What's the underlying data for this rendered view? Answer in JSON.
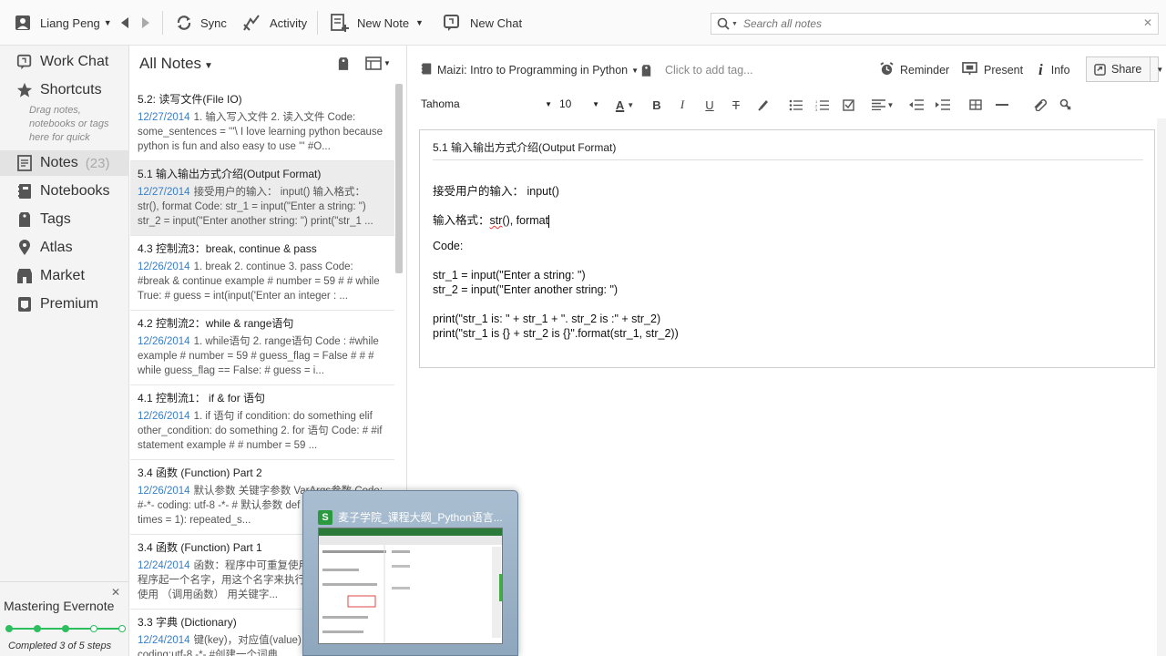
{
  "topbar": {
    "user": "Liang Peng",
    "sync": "Sync",
    "activity": "Activity",
    "new_note": "New Note",
    "new_chat": "New Chat",
    "search_placeholder": "Search all notes"
  },
  "sidebar": {
    "work_chat": "Work Chat",
    "shortcuts": "Shortcuts",
    "hint": "Drag notes, notebooks or tags here for quick",
    "notes": "Notes",
    "notes_count": "(23)",
    "notebooks": "Notebooks",
    "tags": "Tags",
    "atlas": "Atlas",
    "market": "Market",
    "premium": "Premium",
    "mastery_title": "Mastering Evernote",
    "mastery_caption": "Completed 3 of 5 steps",
    "mastery_progress": 0.6
  },
  "notes_list": {
    "header": "All Notes",
    "items": [
      {
        "title": "5.2: 读写文件(File IO)",
        "date": "12/27/2014",
        "body": "1. 输入写入文件 2. 读入文件 Code: some_sentences = '''\\ I love learning python because python is fun and also easy to use ''' #O..."
      },
      {
        "title": "5.1 输入输出方式介绍(Output Format)",
        "date": "12/27/2014",
        "body": "接受用户的输入： input() 输入格式： str(), format Code: str_1 = input(\"Enter a string: \") str_2 = input(\"Enter another string: \") print(\"str_1 ..."
      },
      {
        "title": "4.3 控制流3：break, continue & pass",
        "date": "12/26/2014",
        "body": "1. break 2. continue 3. pass Code: #break & continue example # number = 59 # # while True: # guess = int(input('Enter an integer : ..."
      },
      {
        "title": "4.2 控制流2：while & range语句",
        "date": "12/26/2014",
        "body": "1. while语句 2. range语句 Code : #while example # number = 59 # guess_flag = False # # # while guess_flag == False: # guess = i..."
      },
      {
        "title": "4.1 控制流1： if & for 语句",
        "date": "12/26/2014",
        "body": "1. if 语句 if condition: do something elif other_condition: do something 2. for 语句 Code: # #if statement example # # number = 59 ..."
      },
      {
        "title": "3.4 函数 (Function) Part 2",
        "date": "12/26/2014",
        "body": "默认参数 关键字参数 VarArgs参数 Code: #-*- coding: utf-8 -*- # 默认参数 def repeat_str(s, times = 1): repeated_s..."
      },
      {
        "title": "3.4 函数 (Function) Part 1",
        "date": "12/24/2014",
        "body": "函数：程序中可重复使用的程序段 给一段程序起一个名字，用这个名字来执行一段程序，反复使用 （调用函数） 用关键字..."
      },
      {
        "title": "3.3 字典 (Dictionary)",
        "date": "12/24/2014",
        "body": "键(key)，对应值(value) Code: #-*- coding:utf-8 -*- #创建一个词典..."
      }
    ]
  },
  "editor": {
    "notebook": "Maizi: Intro to Programming in Python",
    "tag_placeholder": "Click to add tag...",
    "reminder": "Reminder",
    "present": "Present",
    "info": "Info",
    "share": "Share",
    "font": "Tahoma",
    "size": "10",
    "title": "5.1 输入输出方式介绍(Output Format)",
    "line1": "接受用户的输入：  input()",
    "line2_a": "输入格式：",
    "line2_b": "str",
    "line2_c": "(), format",
    "line3": "Code:",
    "line4": "str_1 = input(\"Enter a string: \")",
    "line5": "str_2 = input(\"Enter another string: \")",
    "line6": "print(\"str_1 is: \" + str_1 + \". str_2 is :\" + str_2)",
    "line7": "print(\"str_1 is {} + str_2 is {}\".format(str_1, str_2))"
  },
  "preview": {
    "title": "麦子学院_课程大纲_Python语言...",
    "icon_letter": "S"
  }
}
